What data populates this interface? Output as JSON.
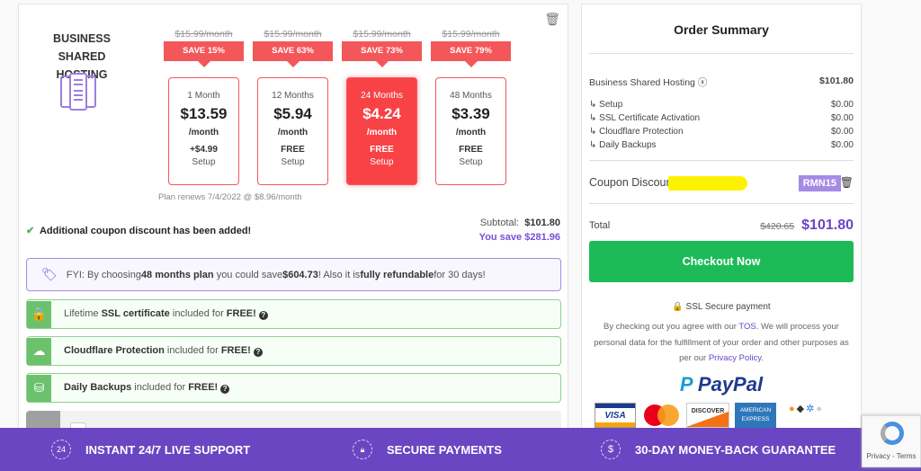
{
  "product": {
    "title_line1": "BUSINESS SHARED",
    "title_line2": "HOSTING"
  },
  "plans": [
    {
      "old_price": "$15.99/month",
      "save": "SAVE 15%",
      "duration": "1 Month",
      "price": "$13.59",
      "per": "/month",
      "setup_price": "+$4.99",
      "setup_label": "Setup",
      "selected": false
    },
    {
      "old_price": "$15.99/month",
      "save": "SAVE 63%",
      "duration": "12 Months",
      "price": "$5.94",
      "per": "/month",
      "setup_price": "FREE",
      "setup_label": "Setup",
      "selected": false
    },
    {
      "old_price": "$15.99/month",
      "save": "SAVE 73%",
      "duration": "24 Months",
      "price": "$4.24",
      "per": "/month",
      "setup_price": "FREE",
      "setup_label": "Setup",
      "selected": true
    },
    {
      "old_price": "$15.99/month",
      "save": "SAVE 79%",
      "duration": "48 Months",
      "price": "$3.39",
      "per": "/month",
      "setup_price": "FREE",
      "setup_label": "Setup",
      "selected": false
    }
  ],
  "renews": "Plan renews 7/4/2022 @ $8.96/month",
  "coupon_msg": "Additional coupon discount has been added!",
  "subtotal": {
    "label": "Subtotal:",
    "value": "$101.80",
    "save_label": "You save",
    "save_value": "$281.96"
  },
  "fyi": {
    "p1": "FYI: By choosing ",
    "b1": "48 months plan",
    "p2": " you could save ",
    "b2": "$604.73",
    "p3": "! Also it is ",
    "b3": "fully refundable",
    "p4": " for 30 days!"
  },
  "features": [
    {
      "pre": "Lifetime ",
      "bold": "SSL certificate",
      "post": " included for ",
      "free": "FREE!"
    },
    {
      "pre": "",
      "bold": "Cloudflare Protection",
      "post": " included for ",
      "free": "FREE!"
    },
    {
      "pre": "",
      "bold": "Daily Backups",
      "post": " included for ",
      "free": "FREE!"
    }
  ],
  "summary": {
    "title": "Order Summary",
    "item": "Business Shared Hosting",
    "item_price": "$101.80",
    "subitems": [
      {
        "label": "↳ Setup",
        "value": "$0.00"
      },
      {
        "label": "↳ SSL Certificate Activation",
        "value": "$0.00"
      },
      {
        "label": "↳ Cloudflare Protection",
        "value": "$0.00"
      },
      {
        "label": "↳ Daily Backups",
        "value": "$0.00"
      }
    ],
    "coupon_label": "Coupon Discount",
    "coupon_code": "RMN15",
    "total_label": "Total",
    "total_old": "$420.65",
    "total": "$101.80",
    "checkout": "Checkout Now",
    "secure": "SSL Secure payment",
    "legal1": "By checking out you agree with our ",
    "tos": "TOS",
    "legal2": ". We will process your personal data for the fulfillment of your order and other purposes as per our ",
    "privacy": "Privacy Policy",
    "legal3": ".",
    "paypal": "PayPal",
    "cards": [
      "VISA",
      "mastercard",
      "DISCOVER",
      "AMERICAN EXPRESS"
    ]
  },
  "footer": [
    {
      "icon": "24",
      "label": "INSTANT 24/7 LIVE SUPPORT"
    },
    {
      "icon": "lock",
      "label": "SECURE PAYMENTS"
    },
    {
      "icon": "$",
      "label": "30-DAY MONEY-BACK GUARANTEE"
    }
  ],
  "recaptcha": "Privacy - Terms",
  "colors": {
    "accent": "#6a46c2",
    "sale": "#f4575a",
    "selected": "#f84245",
    "checkout": "#1dbb57",
    "feature": "#6cc26c"
  }
}
